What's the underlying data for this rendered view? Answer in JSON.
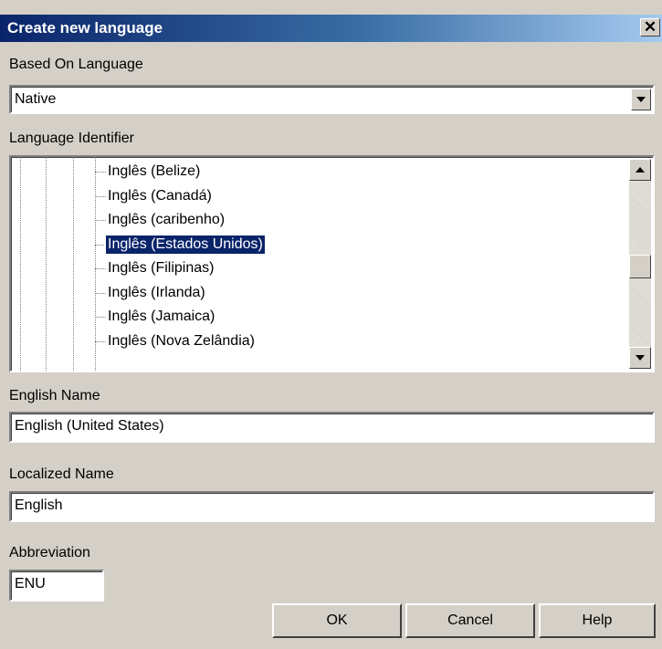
{
  "window": {
    "title": "Create new language",
    "close_glyph": "✕"
  },
  "based_on": {
    "label": "Based On Language",
    "value": "Native"
  },
  "language_identifier": {
    "label": "Language Identifier",
    "items": [
      {
        "label": "Inglês (Belize)",
        "selected": false
      },
      {
        "label": "Inglês (Canadá)",
        "selected": false
      },
      {
        "label": "Inglês (caribenho)",
        "selected": false
      },
      {
        "label": "Inglês (Estados Unidos)",
        "selected": true
      },
      {
        "label": "Inglês (Filipinas)",
        "selected": false
      },
      {
        "label": "Inglês (Irlanda)",
        "selected": false
      },
      {
        "label": "Inglês (Jamaica)",
        "selected": false
      },
      {
        "label": "Inglês (Nova Zelândia)",
        "selected": false
      }
    ]
  },
  "english_name": {
    "label": "English Name",
    "value": "English (United States)"
  },
  "localized_name": {
    "label": "Localized Name",
    "value": "English"
  },
  "abbreviation": {
    "label": "Abbreviation",
    "value": "ENU"
  },
  "buttons": {
    "ok": "OK",
    "cancel": "Cancel",
    "help": "Help"
  }
}
